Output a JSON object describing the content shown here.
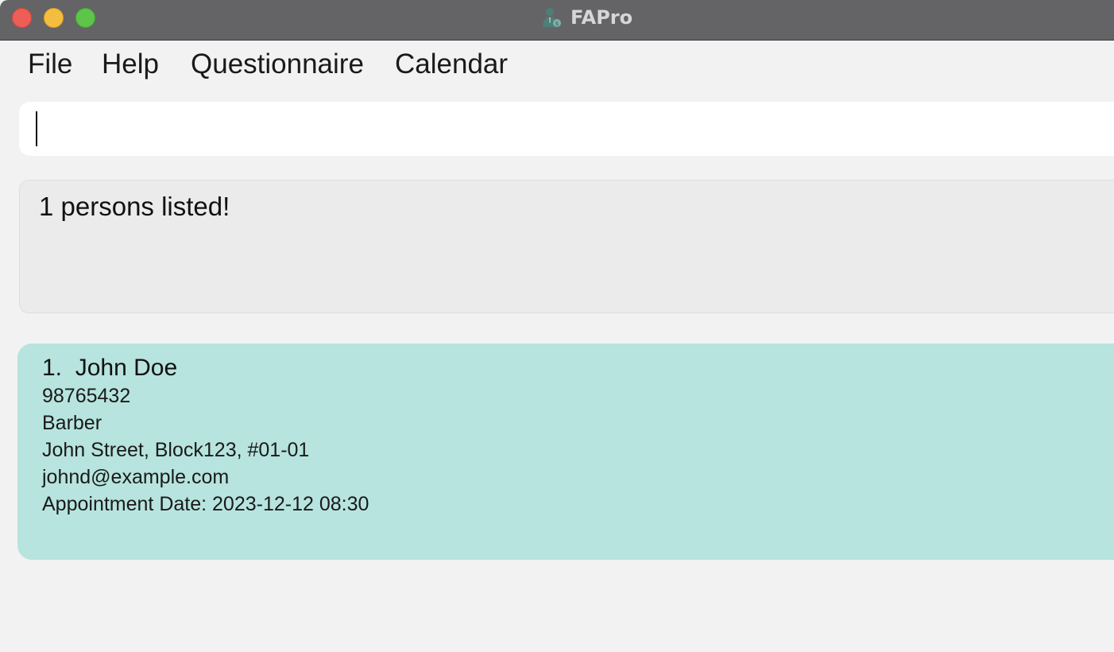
{
  "window": {
    "title": "FAPro",
    "controls": {
      "close": "close-button",
      "minimize": "minimize-button",
      "maximize": "maximize-button"
    }
  },
  "menu": {
    "items": [
      {
        "label": "File"
      },
      {
        "label": "Help"
      },
      {
        "label": "Questionnaire"
      },
      {
        "label": "Calendar"
      }
    ]
  },
  "command": {
    "value": "",
    "placeholder": ""
  },
  "result": {
    "message": "1 persons listed!"
  },
  "persons": [
    {
      "index": "1.",
      "name": "John Doe",
      "phone": "98765432",
      "occupation": "Barber",
      "address": "John Street, Block123, #01-01",
      "email": "johnd@example.com",
      "appointment": "Appointment Date: 2023-12-12 08:30"
    }
  ],
  "colors": {
    "titlebar": "#646466",
    "background": "#f2f2f2",
    "card": "#b7e4de",
    "result_box": "#ebebeb",
    "close": "#ee5e56",
    "minimize": "#f3be40",
    "maximize": "#5ec54a"
  },
  "icons": {
    "app": "advisor-person-icon"
  }
}
